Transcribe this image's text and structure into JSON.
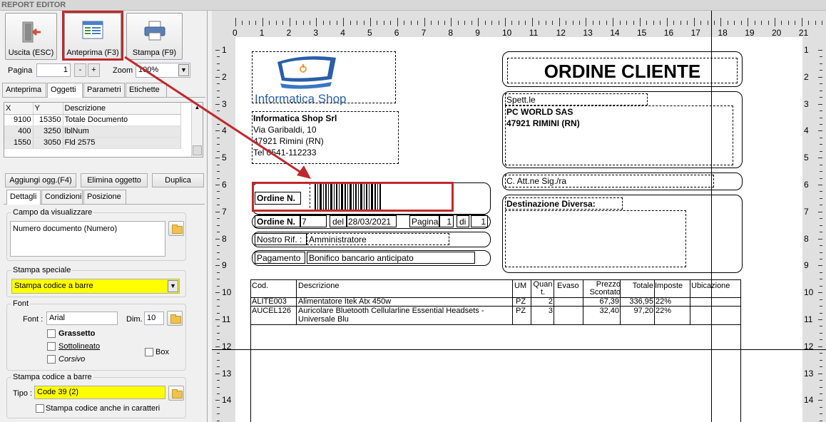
{
  "window": {
    "title": "REPORT EDITOR"
  },
  "toolbar": {
    "exit_label": "Uscita (ESC)",
    "preview_label": "Anteprima (F3)",
    "print_label": "Stampa (F9)"
  },
  "paging": {
    "page_label": "Pagina",
    "page_value": "1",
    "minus": "-",
    "plus": "+",
    "zoom_label": "Zoom",
    "zoom_value": "100%"
  },
  "tabs": [
    "Anteprima",
    "Oggetti",
    "Parametri",
    "Etichette"
  ],
  "objects_grid": {
    "headers": [
      "X",
      "Y",
      "Descrizione"
    ],
    "rows": [
      [
        "9100",
        "15350",
        "Totale Documento"
      ],
      [
        "400",
        "3250",
        "lblNum"
      ],
      [
        "1550",
        "3050",
        "Fld 2575"
      ]
    ]
  },
  "object_buttons": {
    "add": "Aggiungi ogg.(F4)",
    "delete": "Elimina oggetto",
    "duplicate": "Duplica"
  },
  "subtabs": [
    "Dettagli",
    "Condizioni",
    "Posizione"
  ],
  "field_group": {
    "title": "Campo da visualizzare",
    "value": "Numero documento (Numero)"
  },
  "special_print": {
    "title": "Stampa speciale",
    "value": "Stampa codice a barre"
  },
  "font_group": {
    "title": "Font",
    "font_label": "Font :",
    "font_value": "Arial",
    "dim_label": "Dim.",
    "dim_value": "10",
    "bold": "Grassetto",
    "underline": "Sottolineato",
    "italic": "Corsivo",
    "box": "Box"
  },
  "barcode_group": {
    "title": "Stampa codice a barre",
    "type_label": "Tipo :",
    "type_value": "Code 39 (2)",
    "print_chars": "Stampa codice anche in caratteri"
  },
  "ruler": {
    "top": [
      "0",
      "1",
      "2",
      "3",
      "4",
      "5",
      "6",
      "7",
      "8",
      "9",
      "10",
      "11",
      "12",
      "13",
      "14",
      "15",
      "16",
      "17",
      "18",
      "19",
      "20",
      "21"
    ],
    "left": [
      "1",
      "2",
      "3",
      "4",
      "5",
      "6",
      "7",
      "8",
      "9",
      "10",
      "11",
      "12",
      "13",
      "14"
    ]
  },
  "report": {
    "logo_text": "Informatica Shop",
    "company": {
      "name": "Informatica Shop Srl",
      "street": "Via Garibaldi, 10",
      "city": "47921 Rimini (RN)",
      "phone": "Tel 0541-112233"
    },
    "title": "ORDINE CLIENTE",
    "recipient": {
      "label": "Spett.le",
      "name": "PC WORLD SAS",
      "city": "47921 RIMINI (RN)"
    },
    "attn_label": "C. Att.ne Sig./ra",
    "dest_label": "Destinazione Diversa:",
    "barcode_label": "Ordine N.",
    "order": {
      "label": "Ordine N.",
      "number": "7",
      "del_label": "del",
      "date": "28/03/2021",
      "page_label": "Pagina",
      "page": "1",
      "of_label": "di",
      "of": "1"
    },
    "ref": {
      "label": "Nostro Rif. :",
      "value": "Amministratore"
    },
    "payment": {
      "label": "Pagamento",
      "value": "Bonifico bancario anticipato"
    },
    "table": {
      "headers": [
        "Cod.",
        "Descrizione",
        "UM",
        "Quan t.",
        "Evaso",
        "Prezzo Scontato",
        "Totale",
        "Imposte",
        "Ubicazione"
      ],
      "rows": [
        {
          "cod": "ALITE003",
          "desc": "Alimentatore Itek Atx 450w",
          "desc2": "",
          "um": "PZ",
          "qty": "2",
          "evaso": "",
          "price": "67,39",
          "total": "336,95",
          "tax": "22%",
          "loc": ""
        },
        {
          "cod": "AUCEL126",
          "desc": "Auricolare Bluetooth Cellularline Essential Headsets -",
          "desc2": "Universale Blu",
          "um": "PZ",
          "qty": "3",
          "evaso": "",
          "price": "32,40",
          "total": "97,20",
          "tax": "22%",
          "loc": ""
        }
      ]
    }
  }
}
